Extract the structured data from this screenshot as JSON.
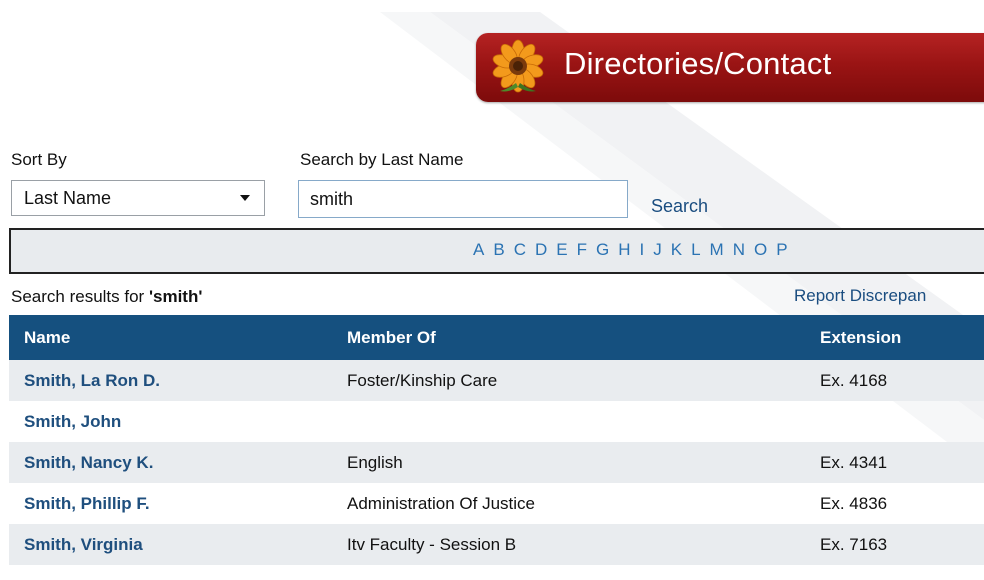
{
  "header": {
    "title": "Directories/Contact",
    "accent": "#9a1414"
  },
  "controls": {
    "sort_label": "Sort By",
    "sort_value": "Last Name",
    "search_label": "Search by Last Name",
    "search_value": "smith",
    "search_button": "Search"
  },
  "alphabet": [
    "A",
    "B",
    "C",
    "D",
    "E",
    "F",
    "G",
    "H",
    "I",
    "J",
    "K",
    "L",
    "M",
    "N",
    "O",
    "P"
  ],
  "results": {
    "prefix": "Search results for ",
    "query": "'smith'",
    "report_link": "Report Discrepan"
  },
  "table": {
    "header_color": "#15507f",
    "columns": [
      "Name",
      "Member Of",
      "Extension"
    ],
    "rows": [
      {
        "name": "Smith, La Ron D.",
        "member": "Foster/Kinship Care",
        "ext": "Ex. 4168"
      },
      {
        "name": "Smith, John",
        "member": "",
        "ext": ""
      },
      {
        "name": "Smith, Nancy K.",
        "member": "English",
        "ext": "Ex. 4341"
      },
      {
        "name": "Smith, Phillip F.",
        "member": "Administration Of Justice",
        "ext": "Ex. 4836"
      },
      {
        "name": "Smith, Virginia",
        "member": "Itv Faculty - Session B",
        "ext": "Ex. 7163"
      }
    ]
  },
  "icons": {
    "banner": "flower-icon",
    "dropdown": "chevron-down-icon"
  }
}
